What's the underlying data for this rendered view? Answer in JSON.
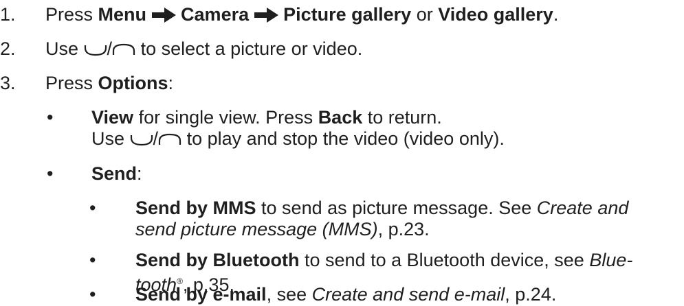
{
  "steps": {
    "s1": {
      "num": "1.",
      "press": "Press",
      "menu": "Menu",
      "camera": "Camera",
      "picture_gallery": "Picture gallery",
      "or": "or",
      "video_gallery": "Video gallery",
      "period": "."
    },
    "s2": {
      "num": "2.",
      "use": "Use",
      "slash": "/",
      "rest": "to select a picture or video."
    },
    "s3": {
      "num": "3.",
      "press": "Press",
      "options": "Options",
      "colon": ":"
    }
  },
  "options": {
    "view": {
      "bullet": "•",
      "label": "View",
      "text1": "for single view. Press",
      "back": "Back",
      "text2": "to return.",
      "use": "Use",
      "slash": "/",
      "text3": "to play and stop the video (video only)."
    },
    "send": {
      "bullet": "•",
      "label": "Send",
      "colon": ":"
    }
  },
  "send_items": {
    "mms": {
      "bullet": "•",
      "label": "Send by MMS",
      "text1": "to send as picture message. See",
      "ref1": "Create and",
      "ref2": "send picture message (MMS)",
      "page": ", p.23."
    },
    "bluetooth": {
      "bullet": "•",
      "label": "Send by Bluetooth",
      "text1": "to send to a Bluetooth device, see",
      "ref1": "Blue-",
      "ref2": "tooth",
      "reg": "®",
      "page": ", p.35."
    },
    "email": {
      "bullet": "•",
      "label": "Send by e-mail",
      "text1": ", see",
      "ref": "Create and send e-mail",
      "page": ", p.24."
    }
  },
  "icons": {
    "arrow": "arrow-right-icon",
    "key_down": "nav-down-key-icon",
    "key_up": "nav-up-key-icon"
  }
}
